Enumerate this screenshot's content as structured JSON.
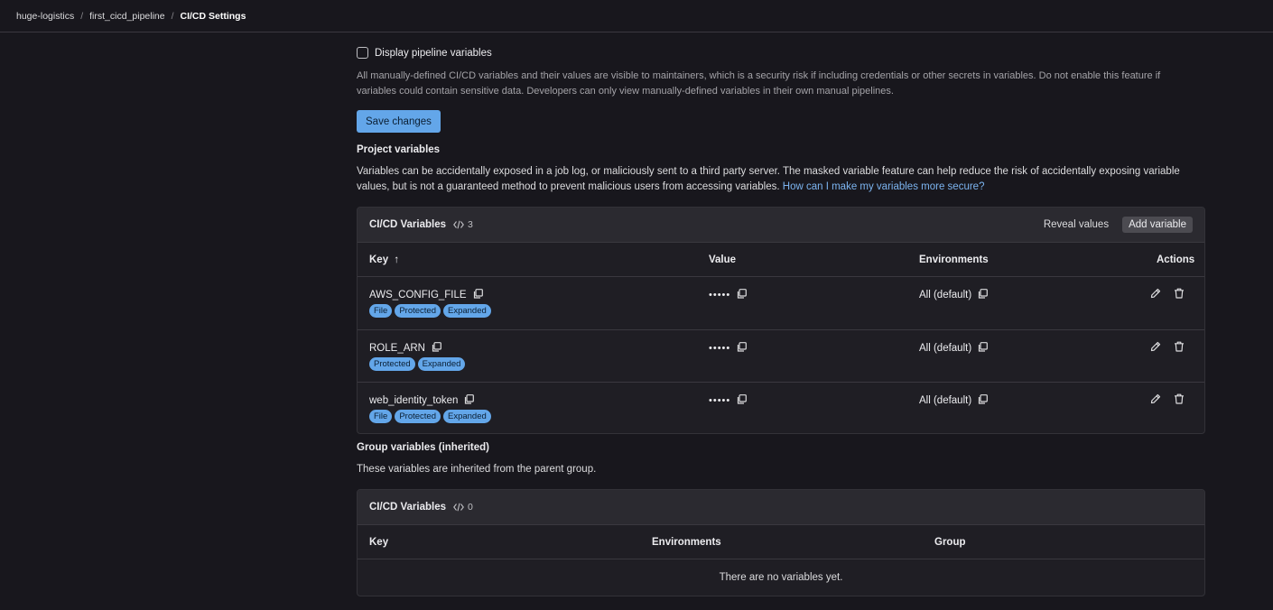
{
  "breadcrumb": {
    "items": [
      "huge-logistics",
      "first_cicd_pipeline",
      "CI/CD Settings"
    ],
    "separator": "/"
  },
  "pipeline_settings": {
    "display_variables_label": "Display pipeline variables",
    "help_text": "All manually-defined CI/CD variables and their values are visible to maintainers, which is a security risk if including credentials or other secrets in variables. Do not enable this feature if variables could contain sensitive data. Developers can only view manually-defined variables in their own manual pipelines.",
    "save_label": "Save changes"
  },
  "project_variables": {
    "title": "Project variables",
    "description": "Variables can be accidentally exposed in a job log, or maliciously sent to a third party server. The masked variable feature can help reduce the risk of accidentally exposing variable values, but is not a guaranteed method to prevent malicious users from accessing variables.",
    "link_text": "How can I make my variables more secure?",
    "card_title": "CI/CD Variables",
    "count": "3",
    "reveal_label": "Reveal values",
    "add_label": "Add variable",
    "columns": {
      "key": "Key",
      "sort_arrow": "↑",
      "value": "Value",
      "environments": "Environments",
      "actions": "Actions"
    },
    "rows": [
      {
        "key": "AWS_CONFIG_FILE",
        "badges": [
          "File",
          "Protected",
          "Expanded"
        ],
        "value": "•••••",
        "environment": "All (default)"
      },
      {
        "key": "ROLE_ARN",
        "badges": [
          "Protected",
          "Expanded"
        ],
        "value": "•••••",
        "environment": "All (default)"
      },
      {
        "key": "web_identity_token",
        "badges": [
          "File",
          "Protected",
          "Expanded"
        ],
        "value": "•••••",
        "environment": "All (default)"
      }
    ]
  },
  "group_variables": {
    "title": "Group variables (inherited)",
    "description": "These variables are inherited from the parent group.",
    "card_title": "CI/CD Variables",
    "count": "0",
    "columns": {
      "key": "Key",
      "environments": "Environments",
      "group": "Group"
    },
    "empty_text": "There are no variables yet."
  },
  "colors": {
    "background": "#18171d",
    "card": "#1f1e24",
    "card_header": "#2b2a30",
    "primary": "#63a6e9",
    "link": "#7cb4f0"
  },
  "icons": {
    "copy": "copy-icon",
    "edit": "pencil-icon",
    "delete": "trash-icon",
    "code": "code-icon"
  }
}
